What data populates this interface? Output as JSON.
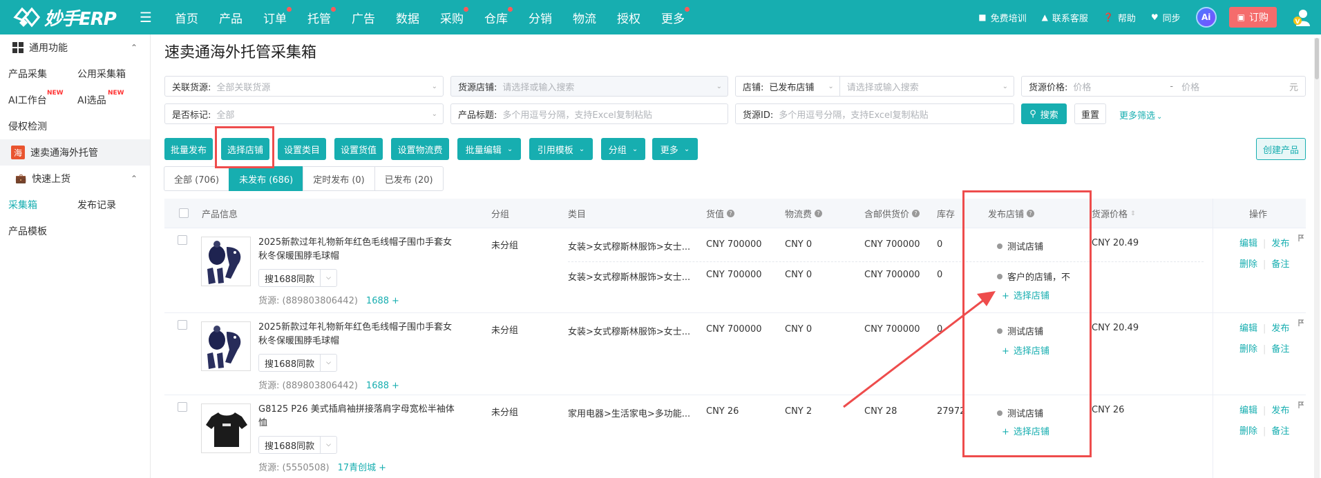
{
  "brand": {
    "name": "妙手ERP"
  },
  "nav": [
    {
      "label": "首页",
      "dot": false
    },
    {
      "label": "产品",
      "dot": false
    },
    {
      "label": "订单",
      "dot": true
    },
    {
      "label": "托管",
      "dot": true
    },
    {
      "label": "广告",
      "dot": false
    },
    {
      "label": "数据",
      "dot": false
    },
    {
      "label": "采购",
      "dot": true
    },
    {
      "label": "仓库",
      "dot": true
    },
    {
      "label": "分销",
      "dot": false
    },
    {
      "label": "物流",
      "dot": false
    },
    {
      "label": "授权",
      "dot": false
    },
    {
      "label": "更多",
      "dot": true
    }
  ],
  "topright": {
    "training": "免费培训",
    "support": "联系客服",
    "help": "帮助",
    "sync": "同步",
    "ai": "Ai",
    "order": "订购"
  },
  "sidebar": {
    "section1": "通用功能",
    "items1": [
      "产品采集",
      "公用采集箱",
      "AI工作台",
      "AI选品"
    ],
    "new_badge": "NEW",
    "infringe": "侵权检测",
    "active_item": "速卖通海外托管",
    "active_icon": "海",
    "section2": "快速上货",
    "items2": [
      "采集箱",
      "发布记录"
    ],
    "template": "产品模板"
  },
  "page": {
    "title": "速卖通海外托管采集箱"
  },
  "filters": {
    "related_source": {
      "label": "关联货源:",
      "placeholder": "全部关联货源"
    },
    "source_store": {
      "label": "货源店铺:",
      "placeholder": "请选择或输入搜索"
    },
    "store": {
      "label": "店铺:",
      "value": "已发布店铺",
      "placeholder": "请选择或输入搜索"
    },
    "source_price": {
      "label": "货源价格:",
      "min_placeholder": "价格",
      "dash": "-",
      "max_placeholder": "价格",
      "unit": "元"
    },
    "marked": {
      "label": "是否标记:",
      "placeholder": "全部"
    },
    "product_title": {
      "label": "产品标题:",
      "placeholder": "多个用逗号分隔，支持Excel复制粘贴"
    },
    "source_id": {
      "label": "货源ID:",
      "placeholder": "多个用逗号分隔，支持Excel复制粘贴"
    },
    "search": "搜索",
    "reset": "重置",
    "more": "更多筛选"
  },
  "actions": [
    "批量发布",
    "选择店铺",
    "设置类目",
    "设置货值",
    "设置物流费",
    "批量编辑",
    "引用模板",
    "分组",
    "更多"
  ],
  "create": "创建产品",
  "tabs": [
    "全部 (706)",
    "未发布 (686)",
    "定时发布 (0)",
    "已发布 (20)"
  ],
  "columns": [
    "产品信息",
    "分组",
    "类目",
    "货值",
    "物流费",
    "含邮供货价",
    "库存",
    "发布店铺",
    "货源价格",
    "操作"
  ],
  "rows": [
    {
      "title": "2025新款过年礼物新年红色毛线帽子围巾手套女秋冬保暖围脖毛球帽",
      "search_btn": "搜1688同款",
      "source": "货源: (889803806442)",
      "source_link": "1688",
      "group": "未分组",
      "subs": [
        {
          "category": "女装>女式穆斯林服饰>女士...",
          "value": "CNY 700000",
          "ship": "CNY 0",
          "supply": "CNY 700000",
          "stock": "0",
          "store": "测试店铺"
        },
        {
          "category": "女装>女式穆斯林服饰>女士...",
          "value": "CNY 700000",
          "ship": "CNY 0",
          "supply": "CNY 700000",
          "stock": "0",
          "store": "客户的店铺，不"
        }
      ],
      "add_store": "选择店铺",
      "src_price": "CNY 20.49",
      "ops": [
        "编辑",
        "发布",
        "删除",
        "备注"
      ]
    },
    {
      "title": "2025新款过年礼物新年红色毛线帽子围巾手套女秋冬保暖围脖毛球帽",
      "search_btn": "搜1688同款",
      "source": "货源: (889803806442)",
      "source_link": "1688",
      "group": "未分组",
      "subs": [
        {
          "category": "女装>女式穆斯林服饰>女士...",
          "value": "CNY 700000",
          "ship": "CNY 0",
          "supply": "CNY 700000",
          "stock": "0",
          "store": "测试店铺"
        }
      ],
      "add_store": "选择店铺",
      "src_price": "CNY 20.49",
      "ops": [
        "编辑",
        "发布",
        "删除",
        "备注"
      ]
    },
    {
      "title": "G8125 P26 美式插肩袖拼接落肩字母宽松半袖体恤",
      "search_btn": "搜1688同款",
      "source": "货源: (5550508)",
      "source_link": "17青创城",
      "group": "未分组",
      "subs": [
        {
          "category": "家用电器>生活家电>多功能...",
          "value": "CNY 26",
          "ship": "CNY 2",
          "supply": "CNY 28",
          "stock": "27972",
          "store": "测试店铺"
        }
      ],
      "add_store": "选择店铺",
      "src_price": "CNY 26",
      "ops": [
        "编辑",
        "发布",
        "删除",
        "备注"
      ]
    }
  ],
  "colors": {
    "accent": "#17aeb0",
    "highlight": "#ee4c4c"
  }
}
